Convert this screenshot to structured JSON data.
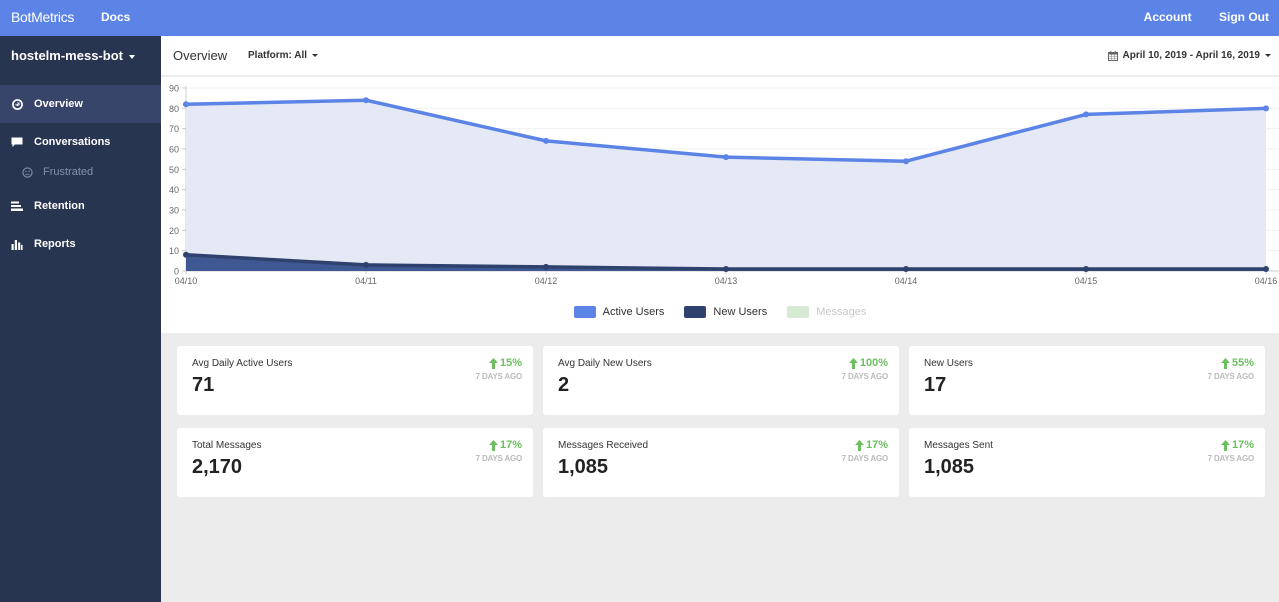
{
  "topbar": {
    "brand": "BotMetrics",
    "docs_label": "Docs",
    "account_label": "Account",
    "signout_label": "Sign Out"
  },
  "sidebar": {
    "bot_name": "hostelm-mess-bot",
    "items": [
      {
        "label": "Overview",
        "icon": "dashboard-icon",
        "active": true
      },
      {
        "label": "Conversations",
        "icon": "chat-icon",
        "active": false
      },
      {
        "label": "Frustrated",
        "icon": "frown-icon",
        "sub": true
      },
      {
        "label": "Retention",
        "icon": "retention-icon",
        "active": false
      },
      {
        "label": "Reports",
        "icon": "bar-chart-icon",
        "active": false
      }
    ]
  },
  "header": {
    "title": "Overview",
    "platform_label": "Platform: All",
    "date_range": "April 10, 2019 - April 16, 2019"
  },
  "colors": {
    "active_users": "#5c84e6",
    "active_users_fill": "#e4e9f5",
    "new_users": "#2f416d",
    "new_users_fill": "#3f5893",
    "messages": "#d6ead3",
    "positive": "#6cbf5f"
  },
  "chart_data": {
    "type": "area",
    "title": "",
    "xlabel": "",
    "ylabel": "",
    "x": [
      "04/10",
      "04/11",
      "04/12",
      "04/13",
      "04/14",
      "04/15",
      "04/16"
    ],
    "ylim": [
      0,
      90
    ],
    "yticks": [
      0,
      10,
      20,
      30,
      40,
      50,
      60,
      70,
      80,
      90
    ],
    "grid": true,
    "legend_position": "bottom-center",
    "series": [
      {
        "name": "Active Users",
        "values": [
          82,
          84,
          64,
          56,
          54,
          77,
          80
        ],
        "visible": true
      },
      {
        "name": "New Users",
        "values": [
          8,
          3,
          2,
          1,
          1,
          1,
          1
        ],
        "visible": true
      },
      {
        "name": "Messages",
        "values": [],
        "visible": false
      }
    ]
  },
  "cards": [
    {
      "label": "Avg Daily Active Users",
      "value": "71",
      "change": "15%",
      "period": "7 DAYS AGO"
    },
    {
      "label": "Avg Daily New Users",
      "value": "2",
      "change": "100%",
      "period": "7 DAYS AGO"
    },
    {
      "label": "New Users",
      "value": "17",
      "change": "55%",
      "period": "7 DAYS AGO"
    },
    {
      "label": "Total Messages",
      "value": "2,170",
      "change": "17%",
      "period": "7 DAYS AGO"
    },
    {
      "label": "Messages Received",
      "value": "1,085",
      "change": "17%",
      "period": "7 DAYS AGO"
    },
    {
      "label": "Messages Sent",
      "value": "1,085",
      "change": "17%",
      "period": "7 DAYS AGO"
    }
  ]
}
